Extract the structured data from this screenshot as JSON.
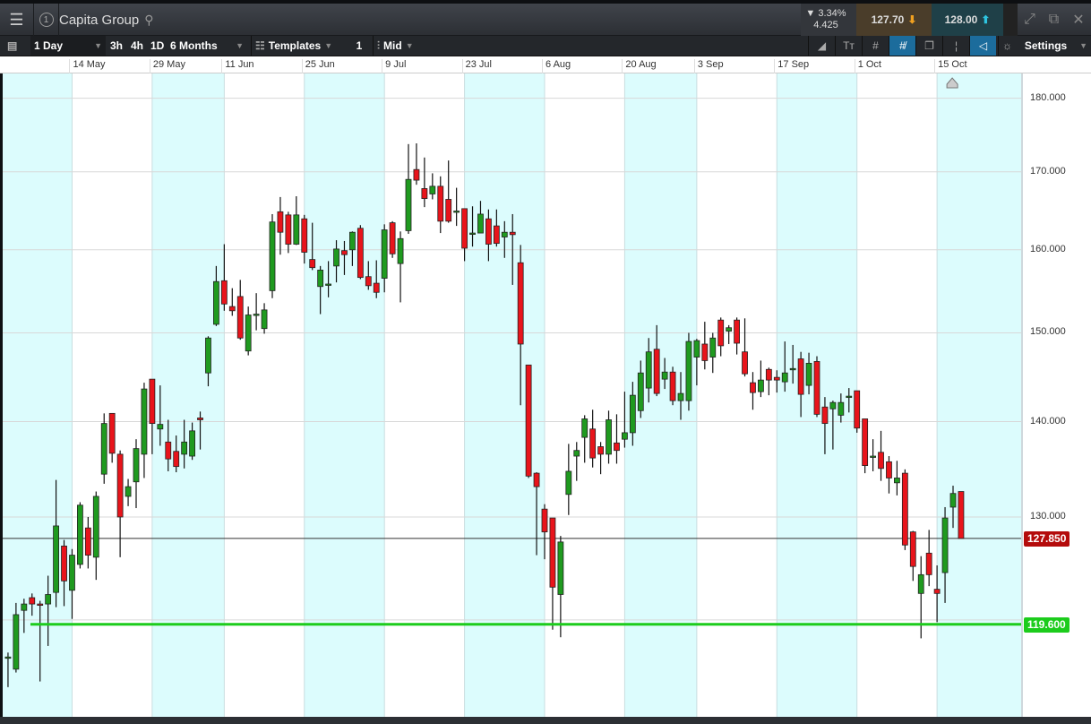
{
  "header": {
    "title": "Capita Group",
    "window_number": "1",
    "change_pct": "▼ 3.34%",
    "change_abs": "4.425",
    "sell_price": "127.70",
    "buy_price": "128.00"
  },
  "toolbar": {
    "interval": "1 Day",
    "quick_3h": "3h",
    "quick_4h": "4h",
    "quick_1d": "1D",
    "range": "6 Months",
    "templates": "Templates",
    "layer_count": "1",
    "price_type": "Mid",
    "settings": "Settings"
  },
  "colors": {
    "up": "#1f9a1f",
    "down": "#e8141b",
    "band": "#dcfcfd",
    "current_price": "#b40b0b",
    "support": "#1ccc1c"
  },
  "chart_data": {
    "type": "candlestick",
    "yscale": "log",
    "ylim": [
      111.3,
      183.5
    ],
    "xlim": [
      -1.0,
      126.5
    ],
    "grid": true,
    "yticks": [
      180,
      170,
      160,
      150,
      140,
      130
    ],
    "ytick_labels": [
      "180.000",
      "170.000",
      "160.000",
      "150.000",
      "140.000",
      "130.000"
    ],
    "xticks": [
      {
        "i": 8,
        "label": "14 May"
      },
      {
        "i": 18,
        "label": "29 May"
      },
      {
        "i": 27,
        "label": "11 Jun"
      },
      {
        "i": 37,
        "label": "25 Jun"
      },
      {
        "i": 47,
        "label": "9 Jul"
      },
      {
        "i": 57,
        "label": "23 Jul"
      },
      {
        "i": 67,
        "label": "6 Aug"
      },
      {
        "i": 77,
        "label": "20 Aug"
      },
      {
        "i": 86,
        "label": "3 Sep"
      },
      {
        "i": 96,
        "label": "17 Sep"
      },
      {
        "i": 106,
        "label": "1 Oct"
      },
      {
        "i": 116,
        "label": "15 Oct"
      }
    ],
    "current_price": {
      "value": 127.85,
      "label": "127.850"
    },
    "support_line": {
      "value": 119.6,
      "label": "119.600",
      "from_index": 2.8
    },
    "ohlc": [
      [
        116.6,
        117.0,
        113.9,
        116.6
      ],
      [
        115.5,
        121.6,
        115.2,
        120.5
      ],
      [
        120.9,
        122.0,
        118.8,
        121.5
      ],
      [
        122.1,
        122.5,
        120.4,
        121.5
      ],
      [
        121.5,
        121.8,
        114.4,
        121.4
      ],
      [
        121.5,
        124.2,
        117.6,
        122.4
      ],
      [
        122.6,
        133.8,
        121.2,
        129.1
      ],
      [
        127.1,
        127.7,
        121.3,
        123.7
      ],
      [
        122.8,
        126.8,
        120.1,
        126.2
      ],
      [
        125.3,
        131.5,
        124.9,
        131.2
      ],
      [
        128.9,
        130.0,
        124.9,
        126.2
      ],
      [
        126.0,
        132.6,
        123.8,
        132.1
      ],
      [
        134.4,
        140.9,
        133.4,
        139.8
      ],
      [
        140.9,
        140.9,
        135.6,
        136.6
      ],
      [
        136.5,
        136.9,
        126.0,
        130.0
      ],
      [
        132.1,
        133.9,
        131.1,
        133.1
      ],
      [
        133.6,
        138.1,
        130.9,
        137.1
      ],
      [
        136.5,
        144.3,
        134.0,
        143.6
      ],
      [
        144.7,
        144.7,
        136.5,
        139.8
      ],
      [
        139.2,
        144.0,
        137.4,
        139.7
      ],
      [
        137.8,
        140.2,
        134.7,
        136.0
      ],
      [
        136.8,
        138.5,
        134.6,
        135.2
      ],
      [
        136.5,
        140.2,
        135.0,
        137.8
      ],
      [
        136.3,
        139.9,
        135.9,
        139.0
      ],
      [
        140.4,
        141.1,
        137.0,
        140.2
      ],
      [
        145.4,
        149.6,
        143.9,
        149.4
      ],
      [
        151.0,
        158.0,
        150.8,
        156.1
      ],
      [
        156.2,
        160.7,
        152.6,
        153.4
      ],
      [
        153.1,
        155.3,
        152.0,
        152.6
      ],
      [
        154.3,
        156.3,
        149.2,
        149.4
      ],
      [
        147.9,
        153.1,
        147.4,
        152.1
      ],
      [
        152.2,
        154.7,
        150.3,
        152.2
      ],
      [
        150.5,
        153.5,
        149.9,
        152.7
      ],
      [
        155.0,
        164.5,
        154.1,
        163.5
      ],
      [
        164.8,
        166.7,
        159.4,
        162.2
      ],
      [
        164.4,
        164.8,
        159.6,
        160.7
      ],
      [
        160.7,
        166.8,
        160.6,
        164.4
      ],
      [
        163.9,
        164.4,
        158.3,
        159.7
      ],
      [
        158.8,
        163.4,
        157.5,
        157.8
      ],
      [
        155.5,
        158.0,
        152.2,
        157.5
      ],
      [
        155.8,
        158.6,
        154.2,
        155.8
      ],
      [
        158.0,
        161.2,
        156.0,
        160.1
      ],
      [
        159.9,
        161.1,
        156.9,
        159.4
      ],
      [
        160.0,
        162.3,
        158.0,
        162.2
      ],
      [
        162.7,
        163.1,
        156.4,
        156.6
      ],
      [
        156.7,
        158.6,
        155.1,
        155.6
      ],
      [
        155.9,
        158.7,
        154.1,
        154.8
      ],
      [
        156.5,
        163.2,
        154.8,
        162.5
      ],
      [
        163.4,
        163.6,
        159.0,
        159.5
      ],
      [
        158.3,
        162.3,
        153.6,
        161.4
      ],
      [
        162.4,
        173.7,
        162.0,
        169.0
      ],
      [
        170.3,
        173.8,
        168.3,
        168.9
      ],
      [
        167.8,
        171.9,
        165.4,
        166.5
      ],
      [
        167.1,
        169.8,
        166.4,
        168.1
      ],
      [
        168.1,
        169.4,
        162.1,
        163.6
      ],
      [
        166.4,
        171.5,
        163.4,
        163.6
      ],
      [
        164.9,
        167.9,
        163.0,
        164.9
      ],
      [
        165.2,
        165.2,
        158.6,
        160.2
      ],
      [
        162.1,
        165.5,
        160.4,
        162.1
      ],
      [
        162.1,
        166.2,
        162.1,
        164.5
      ],
      [
        163.9,
        165.1,
        158.6,
        160.7
      ],
      [
        163.0,
        165.1,
        160.4,
        160.8
      ],
      [
        161.6,
        163.6,
        159.0,
        162.2
      ],
      [
        162.2,
        164.5,
        155.7,
        161.9
      ],
      [
        158.4,
        160.6,
        141.8,
        148.7
      ],
      [
        146.3,
        146.3,
        134.0,
        134.2
      ],
      [
        134.5,
        134.6,
        126.2,
        133.1
      ],
      [
        130.8,
        131.3,
        125.8,
        128.5
      ],
      [
        129.9,
        129.9,
        119.1,
        123.1
      ],
      [
        122.4,
        128.1,
        118.4,
        127.5
      ],
      [
        132.3,
        137.6,
        130.2,
        134.7
      ],
      [
        136.3,
        137.8,
        133.7,
        136.9
      ],
      [
        138.3,
        140.7,
        135.6,
        140.3
      ],
      [
        139.2,
        141.3,
        135.1,
        136.1
      ],
      [
        137.3,
        137.8,
        134.4,
        136.5
      ],
      [
        136.5,
        141.2,
        135.5,
        140.2
      ],
      [
        137.7,
        140.8,
        135.5,
        136.9
      ],
      [
        138.1,
        143.3,
        137.2,
        138.8
      ],
      [
        138.8,
        144.4,
        137.4,
        142.9
      ],
      [
        141.2,
        146.8,
        140.4,
        145.4
      ],
      [
        143.7,
        149.4,
        142.1,
        147.8
      ],
      [
        148.1,
        150.9,
        142.8,
        143.1
      ],
      [
        144.7,
        147.1,
        143.6,
        145.5
      ],
      [
        145.5,
        146.1,
        141.8,
        142.3
      ],
      [
        142.3,
        145.5,
        140.2,
        143.1
      ],
      [
        142.3,
        150.0,
        141.2,
        149.0
      ],
      [
        147.2,
        149.3,
        144.0,
        149.1
      ],
      [
        148.7,
        151.3,
        145.8,
        146.8
      ],
      [
        147.2,
        150.0,
        145.4,
        149.4
      ],
      [
        151.5,
        151.8,
        147.3,
        148.5
      ],
      [
        150.2,
        150.9,
        148.7,
        150.6
      ],
      [
        151.5,
        151.8,
        147.5,
        148.8
      ],
      [
        147.8,
        151.7,
        145.0,
        145.3
      ],
      [
        144.3,
        145.5,
        141.3,
        143.2
      ],
      [
        143.3,
        146.8,
        142.7,
        144.6
      ],
      [
        145.8,
        146.0,
        142.9,
        144.6
      ],
      [
        144.9,
        145.7,
        143.2,
        144.6
      ],
      [
        144.4,
        149.0,
        143.3,
        145.4
      ],
      [
        145.9,
        148.6,
        144.2,
        145.9
      ],
      [
        147.0,
        147.8,
        140.5,
        143.0
      ],
      [
        144.0,
        147.7,
        143.0,
        146.5
      ],
      [
        146.7,
        147.3,
        140.5,
        140.8
      ],
      [
        141.6,
        142.7,
        136.5,
        139.8
      ],
      [
        141.4,
        142.3,
        137.0,
        142.1
      ],
      [
        140.7,
        143.1,
        139.9,
        142.1
      ],
      [
        142.8,
        143.7,
        141.0,
        142.8
      ],
      [
        143.4,
        143.4,
        138.8,
        139.3
      ],
      [
        140.3,
        140.3,
        134.5,
        135.3
      ],
      [
        136.3,
        138.1,
        134.7,
        136.3
      ],
      [
        136.7,
        139.0,
        133.7,
        135.0
      ],
      [
        135.7,
        136.3,
        132.4,
        134.0
      ],
      [
        133.5,
        135.8,
        132.2,
        134.0
      ],
      [
        134.5,
        134.9,
        126.7,
        127.2
      ],
      [
        128.5,
        128.6,
        123.7,
        125.1
      ],
      [
        122.5,
        126.1,
        118.3,
        124.3
      ],
      [
        126.4,
        128.7,
        123.2,
        124.3
      ],
      [
        122.9,
        125.2,
        119.8,
        122.5
      ],
      [
        124.5,
        131.0,
        121.6,
        129.9
      ],
      [
        131.0,
        133.2,
        128.9,
        132.4
      ],
      [
        132.6,
        132.6,
        127.85,
        127.85
      ]
    ]
  }
}
